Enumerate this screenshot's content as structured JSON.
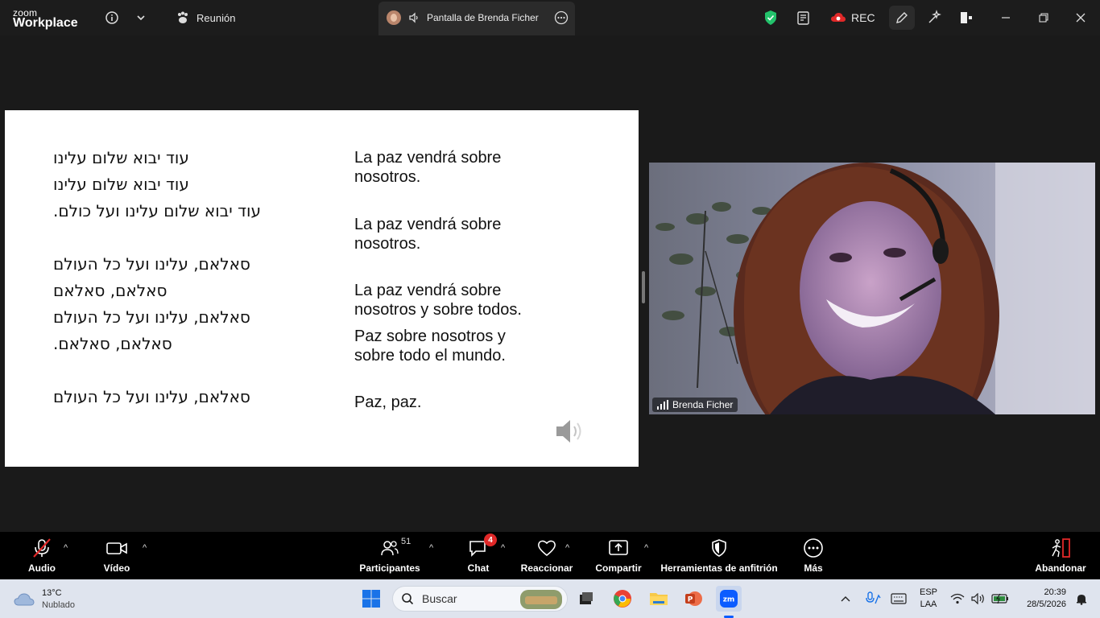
{
  "app": {
    "logo_line1": "zoom",
    "logo_line2": "Workplace",
    "meeting_label": "Reunión",
    "share_tab_label": "Pantalla de Brenda Ficher",
    "rec_label": "REC"
  },
  "slide": {
    "hebrew_lines": [
      "עוד יבוא שלום עלינו",
      "עוד יבוא שלום עלינו",
      "עוד יבוא שלום עלינו ועל כולם.",
      "סאלאם, עלינו ועל כל העולם",
      "סאלאם, סאלאם",
      "סאלאם, עלינו ועל כל העולם",
      "סאלאם, סאלאם.",
      "סאלאם, עלינו ועל כל העולם"
    ],
    "spanish_blocks": [
      [
        "La paz vendrá sobre",
        "nosotros."
      ],
      [
        "La paz vendrá sobre",
        "nosotros."
      ],
      [
        "La paz vendrá sobre",
        "nosotros y sobre todos."
      ],
      [
        "Paz sobre nosotros y",
        "sobre todo el mundo."
      ],
      [
        "Paz, paz."
      ]
    ]
  },
  "video": {
    "participant_name": "Brenda Ficher"
  },
  "toolbar": {
    "audio_label": "Audio",
    "video_label": "Vídeo",
    "participants_label": "Participantes",
    "participants_count": "51",
    "chat_label": "Chat",
    "chat_badge": "4",
    "react_label": "Reaccionar",
    "share_label": "Compartir",
    "host_tools_label": "Herramientas de anfitrión",
    "more_label": "Más",
    "leave_label": "Abandonar"
  },
  "taskbar": {
    "weather_temp": "13°C",
    "weather_desc": "Nublado",
    "search_placeholder": "Buscar",
    "lang_line1": "ESP",
    "lang_line2": "LAA",
    "time": "20:39",
    "date": "28/5/2026"
  },
  "colors": {
    "accent_blue": "#0b5cff",
    "alert_red": "#e02828",
    "shield_green": "#23c26b",
    "leave_red": "#e02828"
  }
}
